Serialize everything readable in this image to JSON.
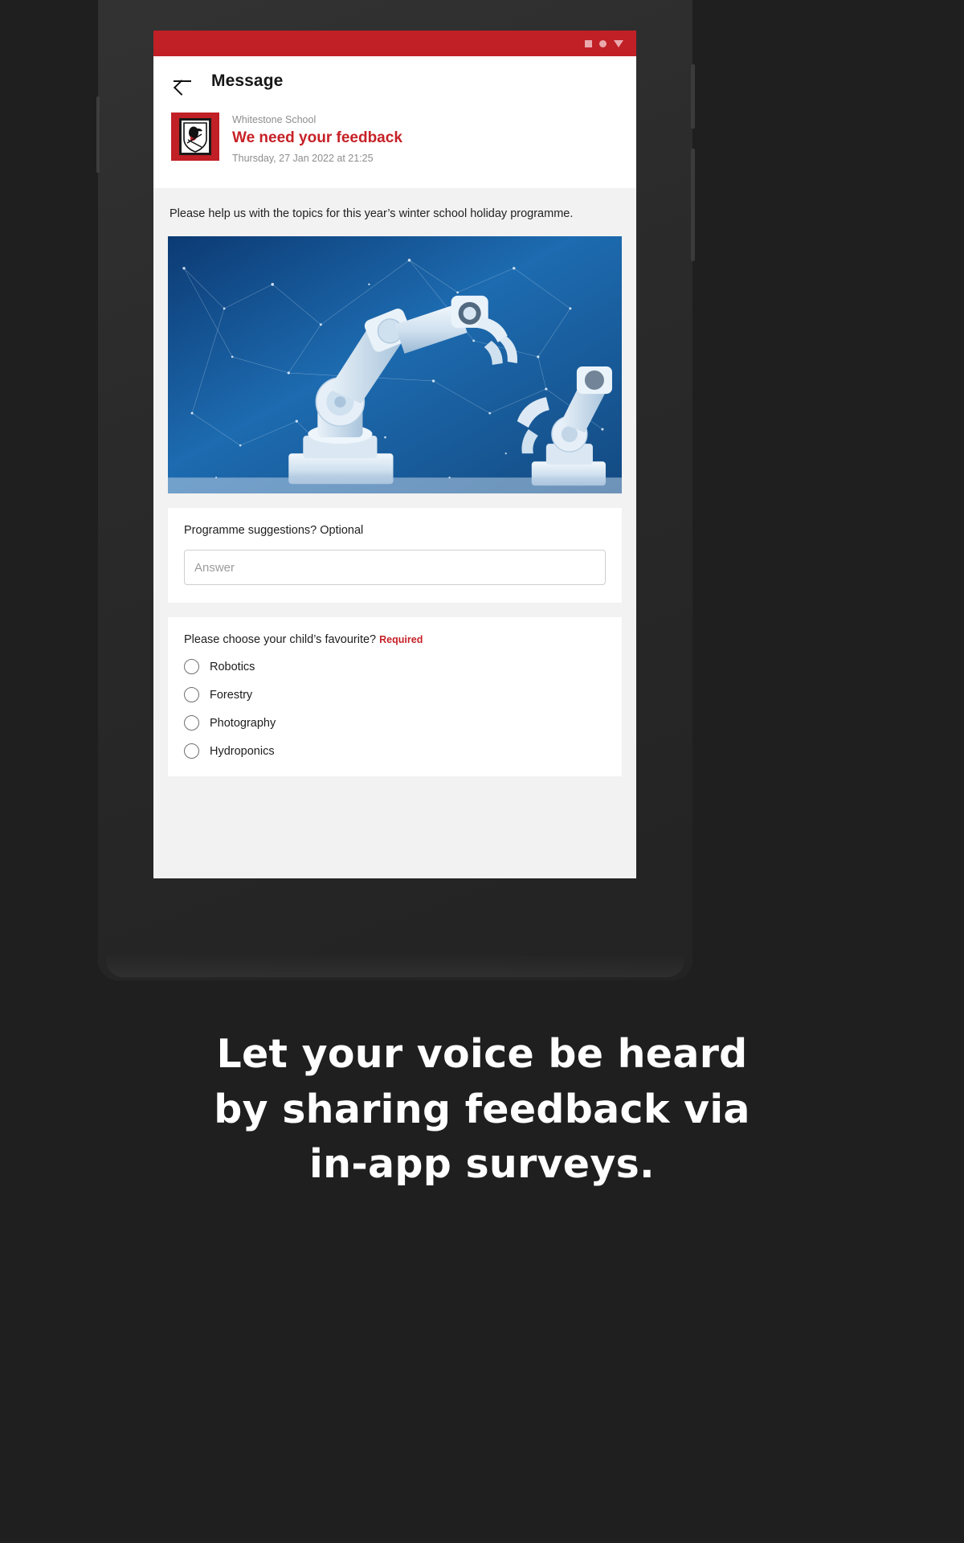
{
  "statusbar": {
    "icons": [
      "square-icon",
      "dot-icon",
      "dropdown-triangle-icon"
    ],
    "bg_color": "#c02026"
  },
  "appbar": {
    "back_label": "back-arrow",
    "title": "Message"
  },
  "message": {
    "logo_alt": "Whitestone School crest",
    "school": "Whitestone School",
    "subject": "We need your feedback",
    "date": "Thursday, 27 Jan 2022 at 21:25",
    "body_text": "Please help us with the topics for this year’s winter school holiday programme.",
    "hero_alt": "Robotic arms over blue network background"
  },
  "form": {
    "question1": {
      "label": "Programme suggestions? Optional",
      "answer_value": "",
      "answer_placeholder": "Answer"
    },
    "question2": {
      "label": "Please choose your child’s favourite?",
      "required_label": "Required",
      "options": [
        {
          "label": "Robotics",
          "selected": false
        },
        {
          "label": "Forestry",
          "selected": false
        },
        {
          "label": "Photography",
          "selected": false
        },
        {
          "label": "Hydroponics",
          "selected": false
        }
      ]
    }
  },
  "navbar": {
    "recent_label": "recent-apps",
    "home_label": "home",
    "back_label": "back"
  },
  "caption": {
    "line1": "Let your voice be heard",
    "line2": "by sharing feedback via",
    "line3": "in-app surveys."
  },
  "colors": {
    "brand_red": "#c02026",
    "accent_red": "#c62127",
    "page_bg": "#1f1f1f",
    "surface": "#f2f2f2"
  }
}
